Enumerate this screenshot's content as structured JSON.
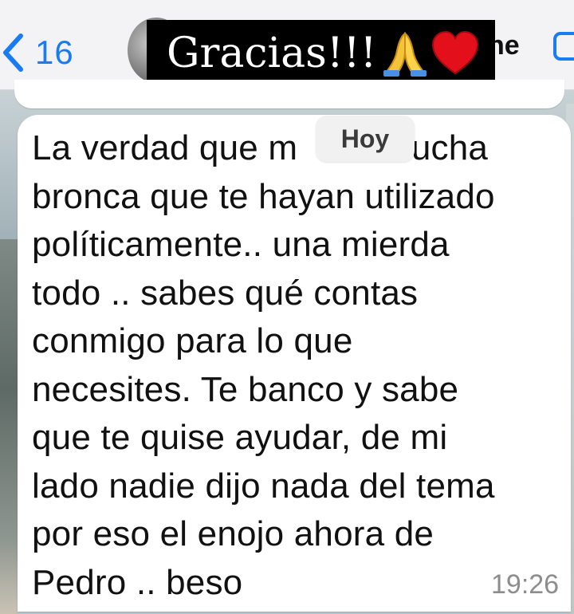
{
  "header": {
    "back_count": "16",
    "contact_name_partial": "he",
    "caption_text": "Gracias!!!",
    "caption_emojis": [
      "folded-hands-icon",
      "red-heart-icon"
    ]
  },
  "date_separator": "Hoy",
  "message": {
    "lines": [
      "La verdad que m",
      "bronca que te hayan utilizado",
      "políticamente.. una mierda",
      "todo .. sabes qué contas",
      "conmigo para lo que",
      "necesites. Te banco y sabe",
      "que te quise ayudar, de mi",
      "lado nadie dijo nada del tema",
      "por eso el enojo ahora de",
      "Pedro .. beso"
    ],
    "line1_tail": "nucha",
    "time": "19:26"
  },
  "colors": {
    "accent_blue": "#1a7cf2",
    "bubble_white": "#ffffff",
    "header_bg": "#f3f3f5",
    "caption_bg": "#000000"
  }
}
